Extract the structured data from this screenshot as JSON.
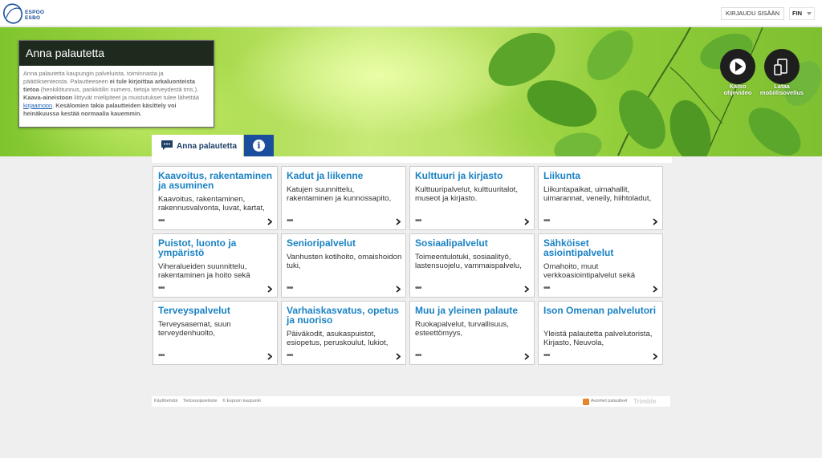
{
  "header": {
    "logo": {
      "line1": "ESPOO",
      "line2": "ESBO"
    },
    "login_label": "KIRJAUDU SISÄÄN",
    "language": "FIN"
  },
  "hero": {
    "info_box": {
      "title": "Anna palautetta",
      "text1": "Anna palautetta kaupungin palveluista, toiminnasta ja päätöksenteosta. Palautteeseen ",
      "bold1": "ei tule kirjoittaa arkaluonteista tietoa",
      "text2": " (henkilötunnus, pankkitilin numero, tietoja terveydestä tms.). ",
      "bold2": "Kaava-aineistoon",
      "text3": " liittyvät mielipiteet ja muistutukset tulee lähettää ",
      "link": "kirjaamoon",
      "text4": ".",
      "bold3": "Kesälomien takia palautteiden käsittely voi heinäkuussa kestää normaalia kauemmin."
    },
    "video_button": {
      "line1": "Katso",
      "line2": "ohjevideo",
      "icon": "play-icon"
    },
    "app_button": {
      "line1": "Lataa",
      "line2": "mobiilisovellus",
      "icon": "mobile-devices-icon"
    }
  },
  "tabs": {
    "feedback_label": "Anna palautetta",
    "feedback_icon": "speech-bubble-icon",
    "info_icon": "info-icon"
  },
  "categories": [
    {
      "title": "Kaavoitus, rakentaminen ja asuminen",
      "description": "Kaavoitus, rakentaminen, rakennusvalvonta, luvat, kartat,"
    },
    {
      "title": "Kadut ja liikenne",
      "description": "Katujen suunnittelu, rakentaminen ja kunnossapito,"
    },
    {
      "title": "Kulttuuri ja kirjasto",
      "description": "Kulttuuripalvelut, kulttuuritalot, museot ja kirjasto."
    },
    {
      "title": "Liikunta",
      "description": "Liikuntapaikat, uimahallit, uimarannat, veneily, hiihtoladut,"
    },
    {
      "title": "Puistot, luonto ja ympäristö",
      "description": "Viheralueiden suunnittelu, rakentaminen ja hoito sekä"
    },
    {
      "title": "Senioripalvelut",
      "description": "Vanhusten kotihoito, omaishoidon tuki,"
    },
    {
      "title": "Sosiaalipalvelut",
      "description": "Toimeentulotuki, sosiaalityö, lastensuojelu, vammaispalvelu,"
    },
    {
      "title": "Sähköiset asiointipalvelut",
      "description": "Omahoito, muut verkkoasiointipalvelut sekä"
    },
    {
      "title": "Terveyspalvelut",
      "description": "Terveysasemat, suun terveydenhuolto,"
    },
    {
      "title": "Varhaiskasvatus, opetus ja nuoriso",
      "description": "Päiväkodit, asukaspuistot, esiopetus, peruskoulut, lukiot,"
    },
    {
      "title": "Muu ja yleinen palaute",
      "description": "Ruokapalvelut, turvallisuus, esteettömyys,"
    },
    {
      "title": "Ison Omenan palvelutori",
      "description": "Yleistä palautetta palvelutorista, Kirjasto, Neuvola,"
    }
  ],
  "card_more": "•••",
  "footer": {
    "terms": "Käyttöehdot",
    "privacy": "Tietosuojaseloste",
    "copyright": "© Espoon kaupunki",
    "rss_label": "Avoimet palautteet",
    "brand": "Trimble"
  },
  "colors": {
    "accent_blue": "#1a4e9c",
    "card_title": "#1a82c4",
    "info_head": "#1f2a1f"
  }
}
